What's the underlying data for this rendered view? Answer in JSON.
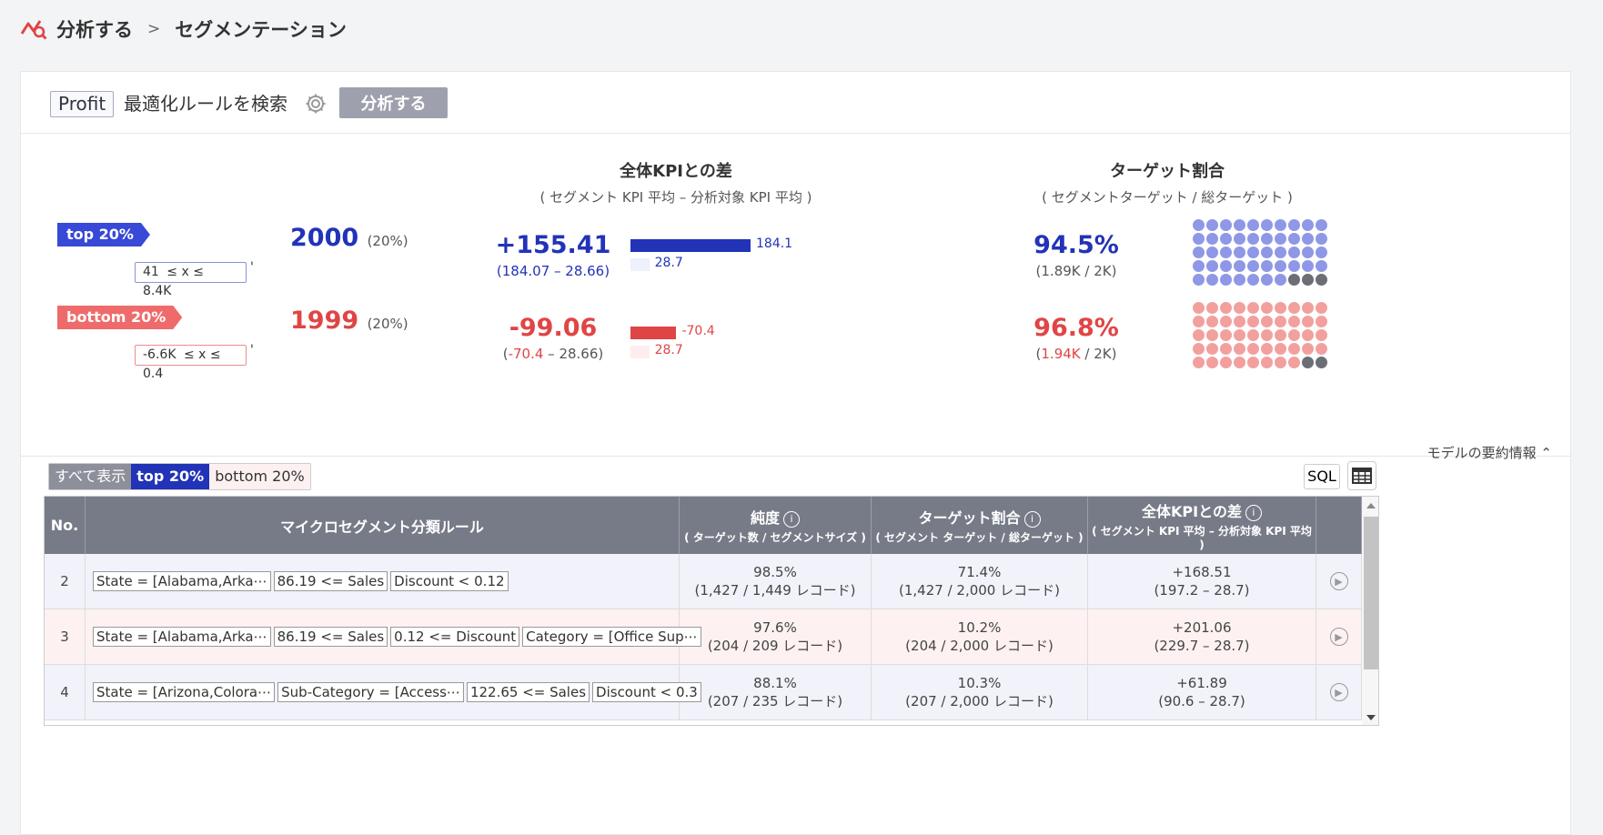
{
  "breadcrumb": {
    "root": "分析する",
    "separator": ">",
    "current": "セグメンテーション"
  },
  "toolbar": {
    "kpi_chip": "Profit",
    "rule_label": "最適化ルールを検索",
    "analyze_label": "分析する"
  },
  "summary": {
    "kpi_title": "全体KPIとの差",
    "kpi_subtitle": "( セグメント KPI 平均 – 分析対象 KPI 平均 )",
    "target_title": "ターゲット割合",
    "target_subtitle": "( セグメントターゲット / 総ターゲット )",
    "top": {
      "tag": "top 20%",
      "range_low": "41",
      "range_op": "≤ x ≤",
      "range_high": "8.4K",
      "range_suffix": "'",
      "count": "2000",
      "count_pct": "(20%)",
      "diff": "+155.41",
      "diff_detail": "(184.07 – 28.66)",
      "bar_value_label": "184.1",
      "bar_base_label": "28.7",
      "bar_value": 184.1,
      "bar_base": 28.7,
      "target_pct": "94.5%",
      "target_detail": "(1.89K / 2K)",
      "target_fraction": 0.945
    },
    "bottom": {
      "tag": "bottom 20%",
      "range_low": "-6.6K",
      "range_op": "≤ x ≤",
      "range_high": "0.4",
      "range_suffix": "'",
      "count": "1999",
      "count_pct": "(20%)",
      "diff": "-99.06",
      "diff_detail_open": "(",
      "diff_detail_neg": "-70.4",
      "diff_detail_rest": " – 28.66)",
      "bar_value_label": "-70.4",
      "bar_base_label": "28.7",
      "bar_value": -70.4,
      "bar_base": 28.7,
      "target_pct": "96.8%",
      "target_detail_open": "(",
      "target_detail_num": "1.94K",
      "target_detail_rest": " / 2K)",
      "target_fraction": 0.968
    }
  },
  "colors": {
    "top": "#2233b8",
    "top_light": "#8f98e6",
    "bottom": "#e04545",
    "bottom_light": "#f2a09e",
    "rest_dot": "#6b6e75"
  },
  "model_info": "モデルの要約情報 ⌃",
  "filters": {
    "all": "すべて表示",
    "top": "top 20%",
    "bottom": "bottom 20%"
  },
  "sql_label": "SQL",
  "table": {
    "headers": {
      "no": "No.",
      "rule": "マイクロセグメント分類ルール",
      "purity": "純度",
      "purity_sub": "( ターゲット数 / セグメントサイズ )",
      "target": "ターゲット割合",
      "target_sub": "( セグメント ターゲット / 総ターゲット )",
      "kpi": "全体KPIとの差",
      "kpi_sub": "( セグメント KPI 平均 – 分析対象 KPI 平均 )"
    },
    "rows": [
      {
        "no": "2",
        "type": "top",
        "conds": [
          "State = [Alabama,Arka⋯",
          "86.19 <= Sales",
          "Discount < 0.12"
        ],
        "purity": "98.5%",
        "purity_detail": "(1,427 / 1,449 レコード)",
        "target": "71.4%",
        "target_detail": "(1,427 / 2,000 レコード)",
        "kpi": "+168.51",
        "kpi_detail": "(197.2 – 28.7)"
      },
      {
        "no": "3",
        "type": "bot",
        "conds": [
          "State = [Alabama,Arka⋯",
          "86.19 <= Sales",
          "0.12 <= Discount",
          "Category = [Office Sup⋯"
        ],
        "purity": "97.6%",
        "purity_detail": "(204 / 209 レコード)",
        "target": "10.2%",
        "target_detail": "(204 / 2,000 レコード)",
        "kpi": "+201.06",
        "kpi_detail": "(229.7 – 28.7)"
      },
      {
        "no": "4",
        "type": "top",
        "conds": [
          "State = [Arizona,Colora⋯",
          "Sub-Category = [Access⋯",
          "122.65 <= Sales",
          "Discount < 0.3"
        ],
        "purity": "88.1%",
        "purity_detail": "(207 / 235 レコード)",
        "target": "10.3%",
        "target_detail": "(207 / 2,000 レコード)",
        "kpi": "+61.89",
        "kpi_detail": "(90.6 – 28.7)"
      }
    ]
  }
}
